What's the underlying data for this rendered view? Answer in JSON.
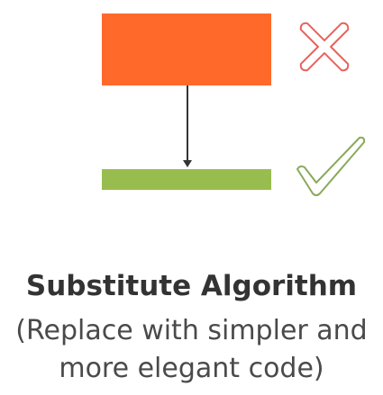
{
  "title": "Substitute Algorithm",
  "subtitle": "(Replace with simpler and more elegant code)",
  "colors": {
    "old_block": "#ff6a2b",
    "new_bar": "#98bd4e",
    "cross_stroke": "#e8625a",
    "check_stroke": "#8aa95a",
    "arrow": "#333333",
    "text": "#333333"
  },
  "icons": {
    "old": "cross-icon",
    "new": "check-icon"
  }
}
